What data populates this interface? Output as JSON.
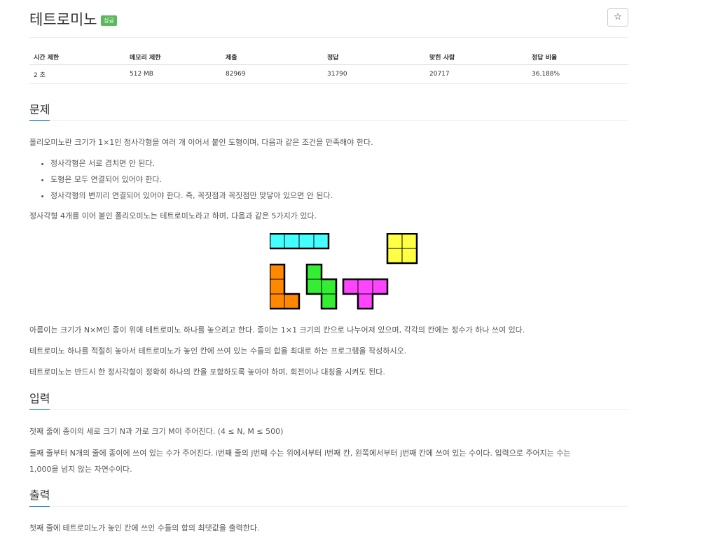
{
  "problem": {
    "title": "테트로미노",
    "status_badge": "성공",
    "star_icon": "☆"
  },
  "info_table": {
    "headers": [
      "시간 제한",
      "메모리 제한",
      "제출",
      "정답",
      "맞힌 사람",
      "정답 비율"
    ],
    "values": [
      "2 초",
      "512 MB",
      "82969",
      "31790",
      "20717",
      "36.188%"
    ]
  },
  "sections": {
    "problem_heading": "문제",
    "input_heading": "입력",
    "output_heading": "출력"
  },
  "problem_text": {
    "intro": "폴리오미노란 크기가 1×1인 정사각형을 여러 개 이어서 붙인 도형이며, 다음과 같은 조건을 만족해야 한다.",
    "rules": [
      "정사각형은 서로 겹치면 안 된다.",
      "도형은 모두 연결되어 있어야 한다.",
      "정사각형의 변끼리 연결되어 있어야 한다. 즉, 꼭짓점과 꼭짓점만 맞닿아 있으면 안 된다."
    ],
    "tetromino_intro": "정사각형 4개를 이어 붙인 폴리오미노는 테트로미노라고 하며, 다음과 같은 5가지가 있다.",
    "para1": "아름이는 크기가 N×M인 종이 위에 테트로미노 하나를 놓으려고 한다. 종이는 1×1 크기의 칸으로 나누어져 있으며, 각각의 칸에는 정수가 하나 쓰여 있다.",
    "para2": "테트로미노 하나를 적절히 놓아서 테트로미노가 놓인 칸에 쓰여 있는 수들의 합을 최대로 하는 프로그램을 작성하시오.",
    "para3": "테트로미노는 반드시 한 정사각형이 정확히 하나의 칸을 포함하도록 놓아야 하며, 회전이나 대칭을 시켜도 된다."
  },
  "input_text": {
    "line1": "첫째 줄에 종이의 세로 크기 N과 가로 크기 M이 주어진다. (4 ≤ N, M ≤ 500)",
    "line2": "둘째 줄부터 N개의 줄에 종이에 쓰여 있는 수가 주어진다. i번째 줄의 j번째 수는 위에서부터 i번째 칸, 왼쪽에서부터 j번째 칸에 쓰여 있는 수이다. 입력으로 주어지는 수는",
    "line3": "1,000을 넘지 않는 자연수이다."
  },
  "output_text": {
    "line1": "첫째 줄에 테트로미노가 놓인 칸에 쓰인 수들의 합의 최댓값을 출력한다."
  },
  "tetromino_colors": {
    "I": "#44ffff",
    "O": "#ffff44",
    "L": "#ff8800",
    "S": "#33ee33",
    "T": "#ff44ff"
  }
}
